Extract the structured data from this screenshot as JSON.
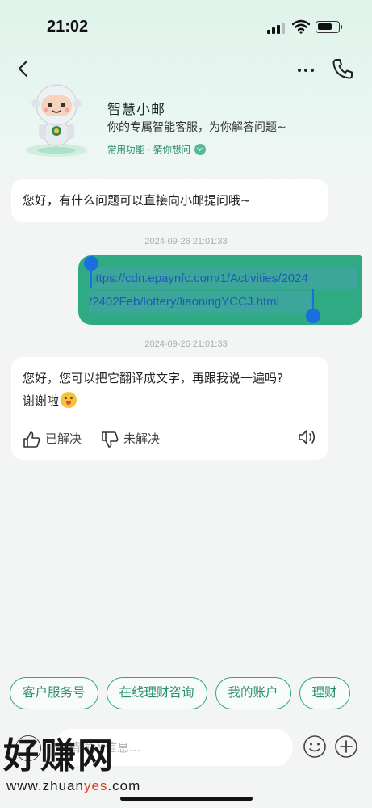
{
  "status_bar": {
    "time": "21:02",
    "battery_level": 0.75
  },
  "header": {
    "back_icon": "chevron-left-icon",
    "more_icon": "more-dots-icon",
    "call_icon": "phone-icon",
    "bot_name": "智慧小邮",
    "bot_description": "你的专属智能客服，为你解答问题~",
    "features_label": "常用功能 · 猜你想问"
  },
  "messages": [
    {
      "sender": "bot",
      "text": "您好，有什么问题可以直接向小邮提问哦~"
    },
    {
      "timestamp": "2024-09-26 21:01:33"
    },
    {
      "sender": "user",
      "line1": "https://cdn.epaynfc.com/1/Activities/2024",
      "line2": "/2402Feb/lottery/liaoningYCCJ.html"
    },
    {
      "timestamp": "2024-09-26 21:01:33"
    },
    {
      "sender": "bot",
      "text_line1": "您好，您可以把它翻译成文字，再跟我说一遍吗?",
      "text_line2": "谢谢啦",
      "resolved_label": "已解决",
      "unresolved_label": "未解决"
    }
  ],
  "quick_actions": [
    "客户服务号",
    "在线理财咨询",
    "我的账户",
    "理财"
  ],
  "input": {
    "placeholder": "请输入信息..."
  },
  "watermark": {
    "big": "好赚网",
    "small_prefix": "www.zhuan",
    "small_red": "yes",
    "small_suffix": ".com"
  },
  "colors": {
    "accent": "#2faa82",
    "link": "#1e5bb5",
    "selection_handle": "#1a6fe0"
  }
}
